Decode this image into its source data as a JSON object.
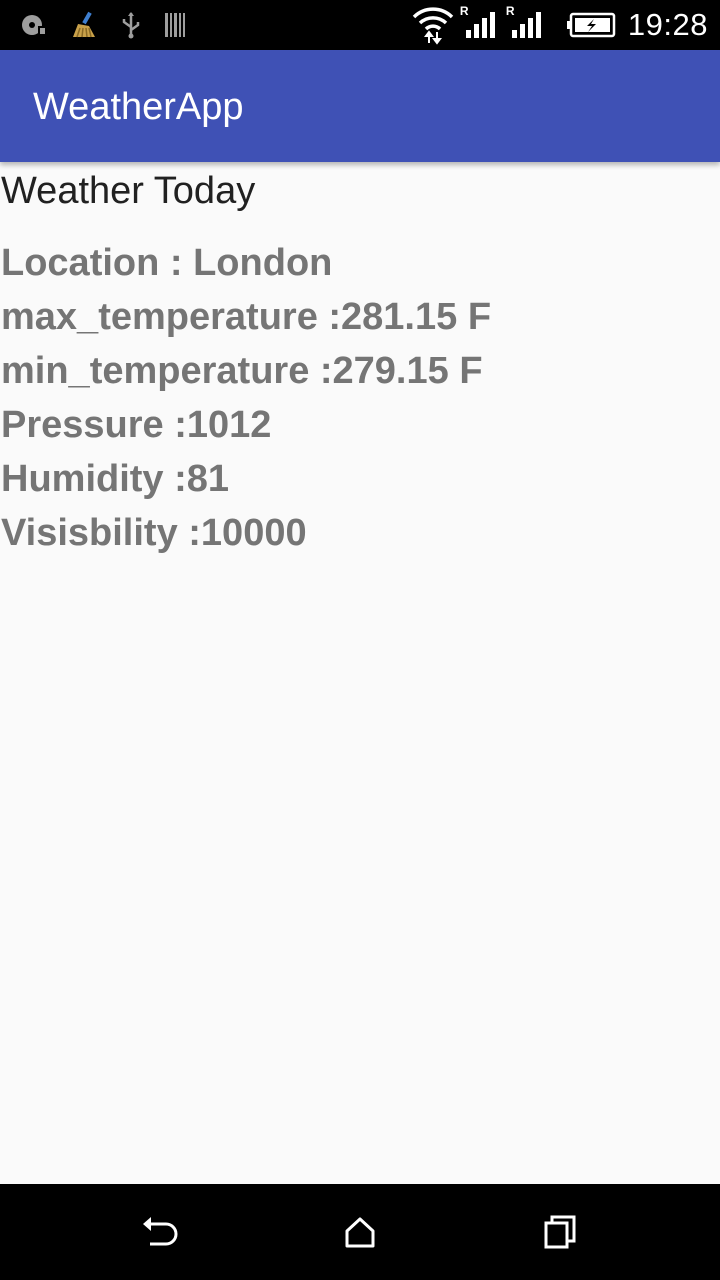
{
  "status_bar": {
    "time": "19:28",
    "icons": [
      "screenshot-icon",
      "cleaner-broom-icon",
      "usb-icon",
      "barcode-icon",
      "wifi-icon",
      "signal-icon",
      "signal-icon",
      "battery-charging-icon"
    ],
    "roaming_label": "R"
  },
  "app_bar": {
    "title": "WeatherApp",
    "color": "#3f51b5"
  },
  "main": {
    "heading": "Weather Today",
    "lines": [
      "Location : London",
      "max_temperature :281.15 F",
      "min_temperature :279.15 F",
      "Pressure :1012",
      "Humidity :81",
      "Visisbility :10000"
    ]
  },
  "nav_bar": {
    "icons": [
      "back-icon",
      "home-icon",
      "recents-icon"
    ]
  }
}
